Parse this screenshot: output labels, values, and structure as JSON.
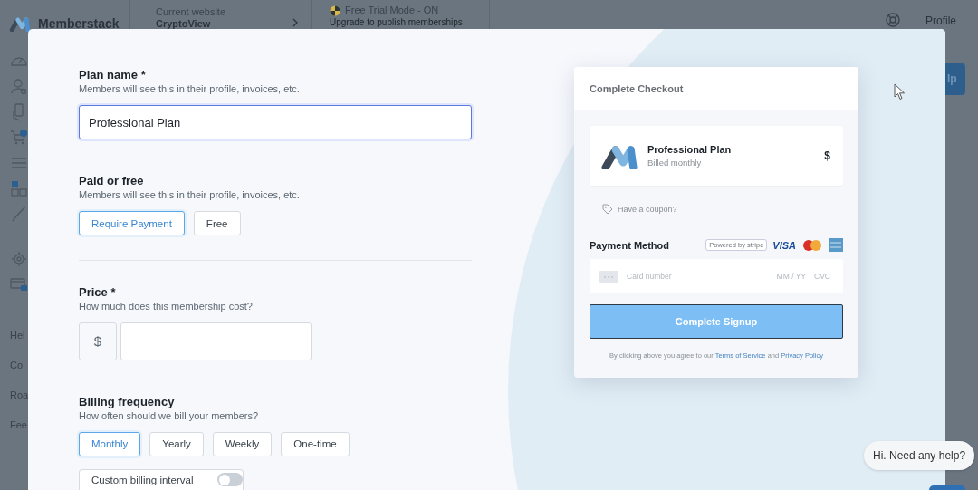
{
  "app_header": {
    "brand": "Memberstack",
    "website_label": "Current website",
    "website_name": "CryptoView",
    "trial_title": "Free Trial Mode - ON",
    "trial_subtitle": "Upgrade to publish memberships",
    "profile": "Profile"
  },
  "sidebar": {
    "links": [
      "Hel",
      "Co",
      "Roa",
      "Fee"
    ]
  },
  "background_button": {
    "label": "lp"
  },
  "plan_form": {
    "plan_name": {
      "label": "Plan name *",
      "hint": "Members will see this in their profile, invoices, etc.",
      "value": "Professional Plan"
    },
    "payment_type": {
      "label": "Paid or free",
      "hint": "Members will see this in their profile, invoices, etc.",
      "options": [
        {
          "label": "Require Payment",
          "selected": true
        },
        {
          "label": "Free",
          "selected": false
        }
      ]
    },
    "price": {
      "label": "Price *",
      "hint": "How much does this membership cost?",
      "currency": "$"
    },
    "billing_frequency": {
      "label": "Billing frequency",
      "hint": "How often should we bill your members?",
      "options": [
        {
          "label": "Monthly",
          "selected": true
        },
        {
          "label": "Yearly",
          "selected": false
        },
        {
          "label": "Weekly",
          "selected": false
        },
        {
          "label": "One-time",
          "selected": false
        }
      ]
    },
    "custom_interval": {
      "label": "Custom billing interval",
      "on": false
    }
  },
  "checkout_preview": {
    "title": "Complete Checkout",
    "plan_name": "Professional Plan",
    "plan_period": "Billed monthly",
    "price": "$",
    "coupon": "Have a coupon?",
    "payment_method": "Payment Method",
    "stripe_badge": "Powered by stripe",
    "visa": "VISA",
    "card_placeholder": "Card number",
    "expiry_placeholder": "MM / YY",
    "cvc_placeholder": "CVC",
    "submit": "Complete Signup",
    "legal_prefix": "By clicking above you agree to our",
    "terms_link": "Terms of Service",
    "legal_joiner": "and",
    "privacy_link": "Privacy Policy"
  },
  "chat": {
    "message": "Hi. Need any help?"
  }
}
